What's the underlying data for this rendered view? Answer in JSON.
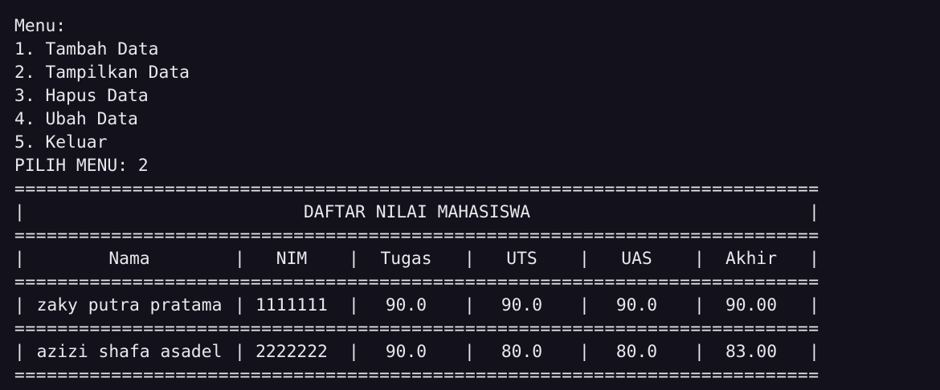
{
  "menu": {
    "heading": "Menu:",
    "items": [
      "1. Tambah Data",
      "2. Tampilkan Data",
      "3. Hapus Data",
      "4. Ubah Data",
      "5. Keluar"
    ],
    "prompt": "PILIH MENU: 2"
  },
  "table": {
    "separator": "===========================================================================",
    "title": "DAFTAR NILAI MAHASISWA",
    "headers": [
      "Nama",
      "NIM",
      "Tugas",
      "UTS",
      "UAS",
      "Akhir"
    ],
    "rows": [
      [
        "zaky putra pratama",
        "1111111",
        "90.0",
        "90.0",
        "90.0",
        "90.00"
      ],
      [
        "azizi shafa asadel",
        "2222222",
        "90.0",
        "80.0",
        "80.0",
        "83.00"
      ]
    ],
    "bar": "|"
  },
  "colors": {
    "background": "#13111c",
    "text": "#e8e8ec"
  }
}
